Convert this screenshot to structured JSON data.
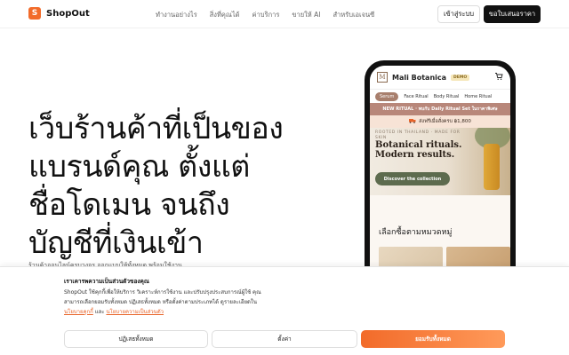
{
  "header": {
    "logo_letter": "S",
    "brand": "ShopOut",
    "nav": [
      "ทำงานอย่างไร",
      "สิ่งที่คุณได้",
      "ค่าบริการ",
      "ขายให้ AI",
      "สำหรับเอเจนซี"
    ],
    "login_label": "เข้าสู่ระบบ",
    "quote_label": "ขอใบเสนอราคา"
  },
  "hero": {
    "title_lines": [
      "เว็บร้านค้าที่เป็นของ",
      "แบรนด์คุณ ตั้งแต่",
      "ชื่อโดเมน จนถึง",
      "บัญชีที่เงินเข้า"
    ],
    "subtitle": "ร้านค้าออนไลน์ครบวงจร ออกแบบให้ทั้งหมด พร้อมใช้งาน"
  },
  "phone": {
    "mark": "M",
    "brand": "Mali Botanica",
    "demo_badge": "DEMO",
    "cart_icon": "cart-icon",
    "tabs": [
      "Serum",
      "Face Ritual",
      "Body Ritual",
      "Home Ritual"
    ],
    "banner": "NEW RITUAL · พบกับ Daily Ritual Set ในราคาพิเศษ",
    "shipping_icon": "truck-icon",
    "shipping": "ส่งฟรีเมื่อสั่งครบ ฿1,800",
    "kicker": "ROOTED IN THAILAND · MADE FOR SKIN",
    "headline": "Botanical rituals. Modern results.",
    "cta": "Discover the collection",
    "section_title": "เลือกซื้อตามหมวดหมู่"
  },
  "cookie": {
    "title": "เราเคารพความเป็นส่วนตัวของคุณ",
    "body": "ShopOut ใช้คุกกี้เพื่อให้บริการ วิเคราะห์การใช้งาน และปรับปรุงประสบการณ์ผู้ใช้ คุณสามารถเลือกยอมรับทั้งหมด ปฏิเสธทั้งหมด หรือตั้งค่าตามประเภทได้ ดูรายละเอียดใน",
    "link1": "นโยบายคุกกี้",
    "and": "และ",
    "link2": "นโยบายความเป็นส่วนตัว",
    "reject_label": "ปฏิเสธทั้งหมด",
    "settings_label": "ตั้งค่า",
    "accept_label": "ยอมรับทั้งหมด"
  },
  "colors": {
    "accent": "#f26b2a",
    "dark": "#111111",
    "banner": "#b8877a",
    "cta_green": "#5d6b4e"
  }
}
